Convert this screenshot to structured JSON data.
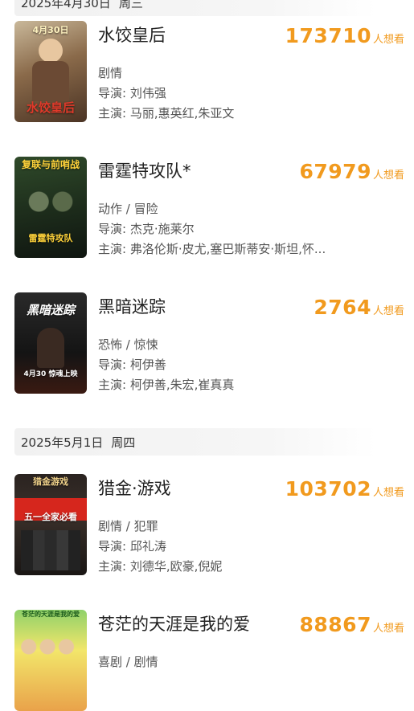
{
  "sections": [
    {
      "date": "2025年4月30日",
      "weekday": "周三",
      "movies": [
        {
          "title": "水饺皇后",
          "wish_count": "173710",
          "wish_unit": "人想看",
          "genre": "剧情",
          "director_label": "导演: ",
          "director": "刘伟强",
          "cast_label": "主演: ",
          "cast": "马丽,惠英红,朱亚文",
          "poster_text": "4月30日",
          "poster_caption": "水饺皇后"
        },
        {
          "title": "雷霆特攻队*",
          "wish_count": "67979",
          "wish_unit": "人想看",
          "genre": "动作 / 冒险",
          "director_label": "导演: ",
          "director": "杰克·施莱尔",
          "cast_label": "主演: ",
          "cast": "弗洛伦斯·皮尤,塞巴斯蒂安·斯坦,怀...",
          "poster_text": "复联与前哨战",
          "poster_caption": "雷霆特攻队"
        },
        {
          "title": "黑暗迷踪",
          "wish_count": "2764",
          "wish_unit": "人想看",
          "genre": "恐怖 / 惊悚",
          "director_label": "导演: ",
          "director": "柯伊善",
          "cast_label": "主演: ",
          "cast": "柯伊善,朱宏,崔真真",
          "poster_text": "黑暗迷踪",
          "poster_caption": "4月30 惊魂上映"
        }
      ]
    },
    {
      "date": "2025年5月1日",
      "weekday": "周四",
      "movies": [
        {
          "title": "猎金·游戏",
          "wish_count": "103702",
          "wish_unit": "人想看",
          "genre": "剧情 / 犯罪",
          "director_label": "导演: ",
          "director": "邱礼涛",
          "cast_label": "主演: ",
          "cast": "刘德华,欧豪,倪妮",
          "poster_text": "猎金游戏",
          "poster_caption": "五一全家必看"
        },
        {
          "title": "苍茫的天涯是我的爱",
          "wish_count": "88867",
          "wish_unit": "人想看",
          "genre": "喜剧 / 剧情",
          "poster_text": "苍茫的天涯是我的爱"
        }
      ]
    }
  ]
}
